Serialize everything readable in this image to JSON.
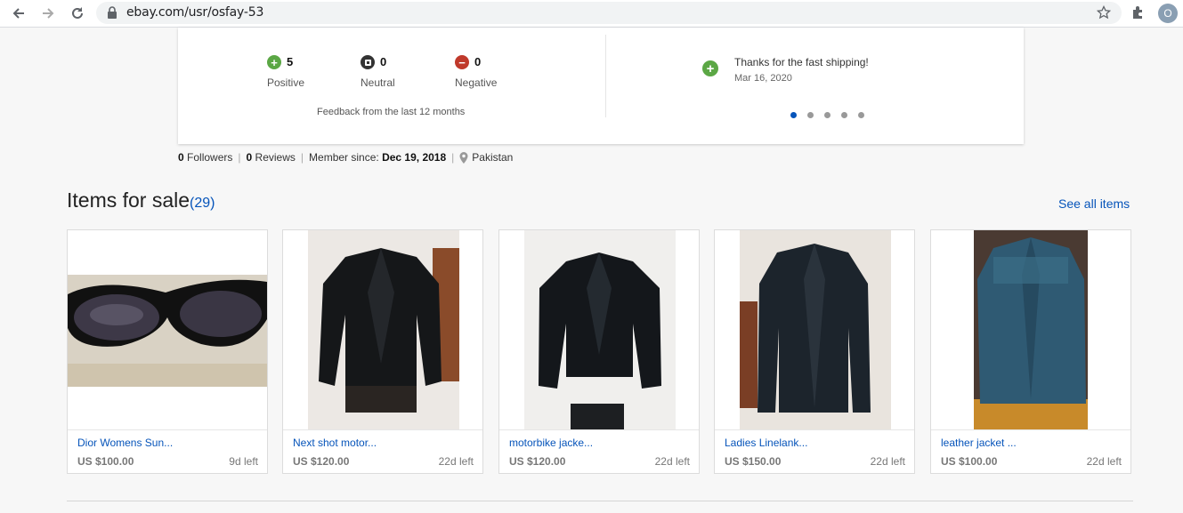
{
  "browser": {
    "url": "ebay.com/usr/osfay-53",
    "profile_initial": "O"
  },
  "feedback": {
    "positive": {
      "count": "5",
      "label": "Positive",
      "color": "#5ba745"
    },
    "neutral": {
      "count": "0",
      "label": "Neutral",
      "color": "#333333"
    },
    "negative": {
      "count": "0",
      "label": "Negative",
      "color": "#c0392b"
    },
    "period": "Feedback from the last 12 months",
    "latest_comment": {
      "text": "Thanks for the fast shipping!",
      "date": "Mar 16, 2020"
    },
    "carousel_pages": 5,
    "carousel_active": 1
  },
  "profile_meta": {
    "followers_count": "0",
    "followers_label": "Followers",
    "reviews_count": "0",
    "reviews_label": "Reviews",
    "member_since_label": "Member since:",
    "member_since": "Dec 19, 2018",
    "location": "Pakistan"
  },
  "items_section": {
    "title": "Items for sale",
    "count": "(29)",
    "see_all": "See all items"
  },
  "items": [
    {
      "title": "Dior Womens Sun...",
      "price": "US $100.00",
      "time_left": "9d left",
      "image": "sunglasses"
    },
    {
      "title": "Next shot motor...",
      "price": "US $120.00",
      "time_left": "22d left",
      "image": "leather-jacket"
    },
    {
      "title": "motorbike jacke...",
      "price": "US $120.00",
      "time_left": "22d left",
      "image": "leather-jacket"
    },
    {
      "title": "Ladies Linelank...",
      "price": "US $150.00",
      "time_left": "22d left",
      "image": "leather-coat"
    },
    {
      "title": "leather jacket ...",
      "price": "US $100.00",
      "time_left": "22d left",
      "image": "blue-leather-jacket"
    }
  ]
}
